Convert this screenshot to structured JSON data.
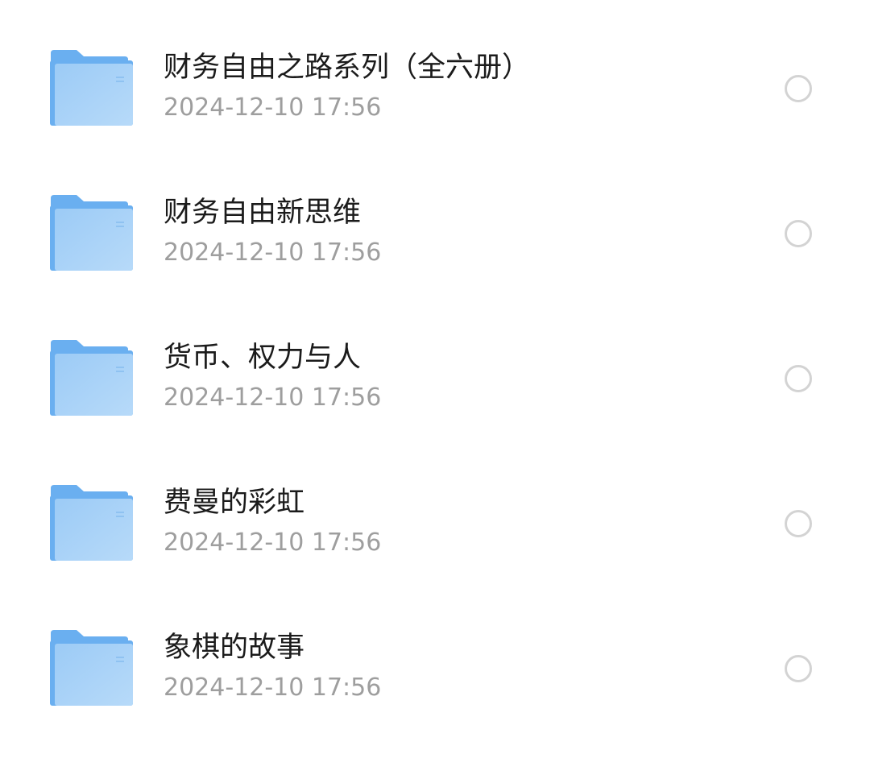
{
  "folders": [
    {
      "name": "财务自由之路系列（全六册）",
      "modified": "2024-12-10 17:56",
      "selected": false
    },
    {
      "name": "财务自由新思维",
      "modified": "2024-12-10 17:56",
      "selected": false
    },
    {
      "name": "货币、权力与人",
      "modified": "2024-12-10 17:56",
      "selected": false
    },
    {
      "name": "费曼的彩虹",
      "modified": "2024-12-10 17:56",
      "selected": false
    },
    {
      "name": "象棋的故事",
      "modified": "2024-12-10 17:56",
      "selected": false
    }
  ],
  "icon": "folder-icon",
  "colors": {
    "folder_back": "#6aaff0",
    "folder_front_top": "#9ccbf6",
    "folder_front_bottom": "#b7daf9",
    "title_text": "#1b1b1b",
    "date_text": "#9e9e9e",
    "radio_border": "#d3d3d3"
  }
}
